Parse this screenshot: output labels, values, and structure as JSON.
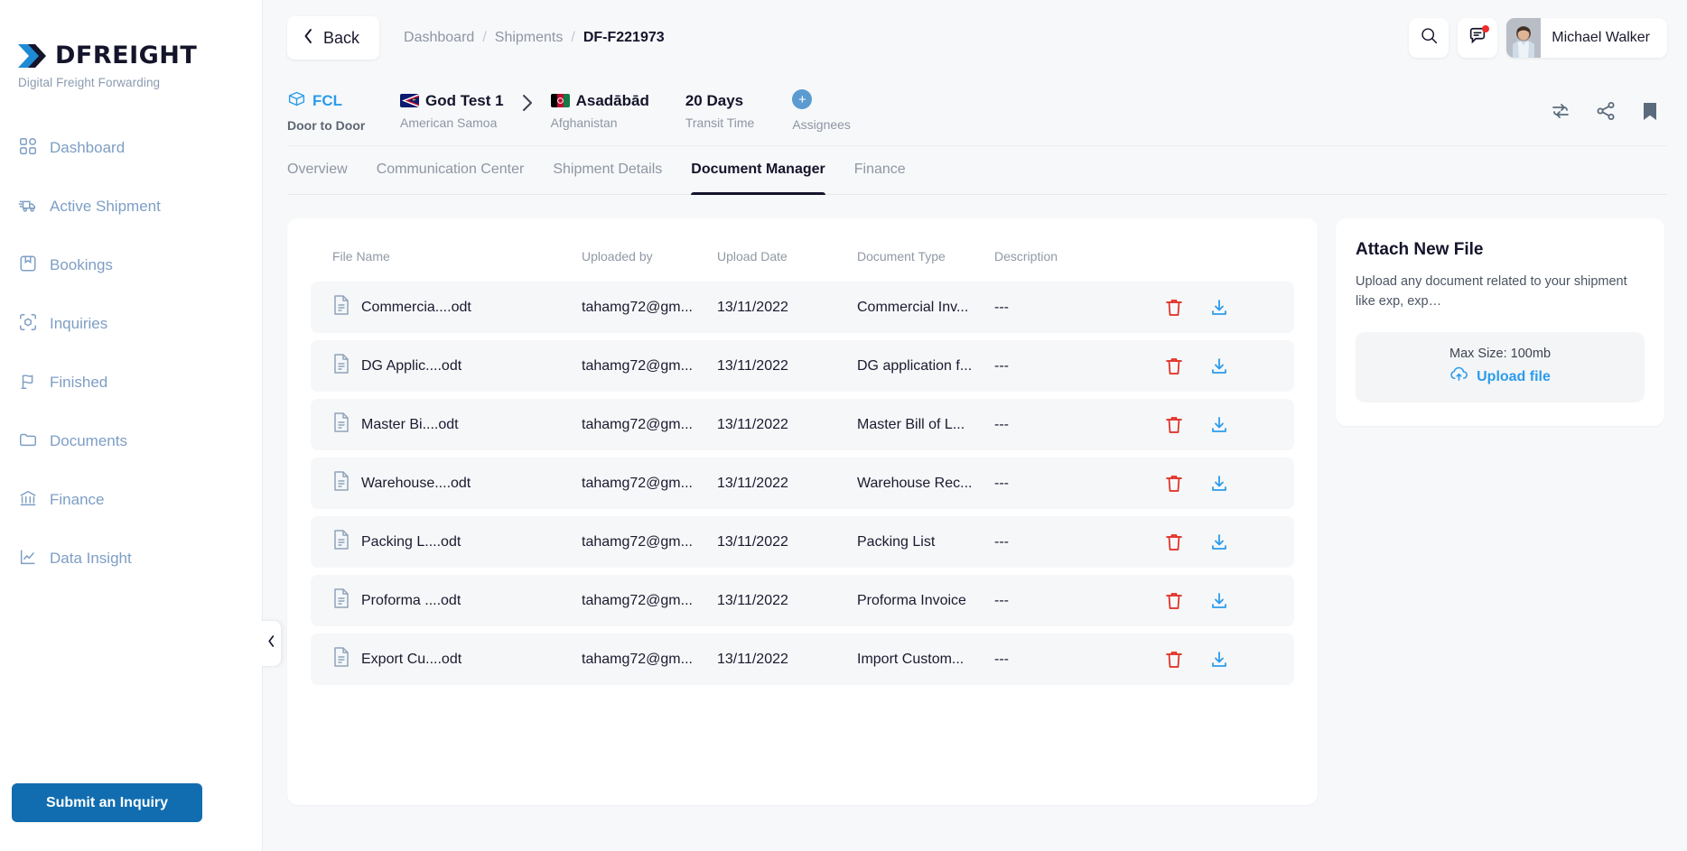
{
  "brand": {
    "name": "DFREIGHT",
    "tagline": "Digital Freight Forwarding",
    "accent": "#2b9ceb",
    "primary": "#116db0"
  },
  "sidebar": {
    "items": [
      {
        "label": "Dashboard",
        "icon": "grid-icon"
      },
      {
        "label": "Active Shipment",
        "icon": "truck-icon"
      },
      {
        "label": "Bookings",
        "icon": "bookmark-box-icon"
      },
      {
        "label": "Inquiries",
        "icon": "cube-scan-icon"
      },
      {
        "label": "Finished",
        "icon": "flag-icon"
      },
      {
        "label": "Documents",
        "icon": "folder-icon"
      },
      {
        "label": "Finance",
        "icon": "bank-icon"
      },
      {
        "label": "Data Insight",
        "icon": "chart-line-icon"
      }
    ],
    "submit_button": "Submit an Inquiry"
  },
  "topbar": {
    "back_label": "Back",
    "breadcrumb": [
      "Dashboard",
      "Shipments",
      "DF-F221973"
    ],
    "breadcrumb_separator": "/",
    "user_name": "Michael Walker"
  },
  "summary": {
    "mode": {
      "title": "FCL",
      "sub": "Door to Door"
    },
    "origin": {
      "title": "God Test 1",
      "sub": "American Samoa",
      "flag": "american-samoa"
    },
    "destination": {
      "title": "Asadābād",
      "sub": "Afghanistan",
      "flag": "afghanistan"
    },
    "transit": {
      "title": "20 Days",
      "sub": "Transit Time"
    },
    "assignees": {
      "title": "+",
      "sub": "Assignees"
    }
  },
  "tabs": [
    {
      "label": "Overview",
      "active": false
    },
    {
      "label": "Communication Center",
      "active": false
    },
    {
      "label": "Shipment Details",
      "active": false
    },
    {
      "label": "Document Manager",
      "active": true
    },
    {
      "label": "Finance",
      "active": false
    }
  ],
  "table": {
    "headers": {
      "file_name": "File Name",
      "uploaded_by": "Uploaded by",
      "upload_date": "Upload Date",
      "document_type": "Document Type",
      "description": "Description"
    },
    "rows": [
      {
        "file_name": "Commercia....odt",
        "uploaded_by": "tahamg72@gm...",
        "upload_date": "13/11/2022",
        "document_type": "Commercial Inv...",
        "description": "---"
      },
      {
        "file_name": "DG Applic....odt",
        "uploaded_by": "tahamg72@gm...",
        "upload_date": "13/11/2022",
        "document_type": "DG application f...",
        "description": "---"
      },
      {
        "file_name": "Master Bi....odt",
        "uploaded_by": "tahamg72@gm...",
        "upload_date": "13/11/2022",
        "document_type": "Master Bill of L...",
        "description": "---"
      },
      {
        "file_name": "Warehouse....odt",
        "uploaded_by": "tahamg72@gm...",
        "upload_date": "13/11/2022",
        "document_type": "Warehouse Rec...",
        "description": "---"
      },
      {
        "file_name": "Packing L....odt",
        "uploaded_by": "tahamg72@gm...",
        "upload_date": "13/11/2022",
        "document_type": "Packing List",
        "description": "---"
      },
      {
        "file_name": "Proforma ....odt",
        "uploaded_by": "tahamg72@gm...",
        "upload_date": "13/11/2022",
        "document_type": "Proforma Invoice",
        "description": "---"
      },
      {
        "file_name": "Export Cu....odt",
        "uploaded_by": "tahamg72@gm...",
        "upload_date": "13/11/2022",
        "document_type": "Import Custom...",
        "description": "---"
      }
    ]
  },
  "attach_panel": {
    "title": "Attach New File",
    "description": "Upload any document related to your shipment like exp, exp…",
    "max_size": "Max Size: 100mb",
    "upload_label": "Upload file"
  }
}
